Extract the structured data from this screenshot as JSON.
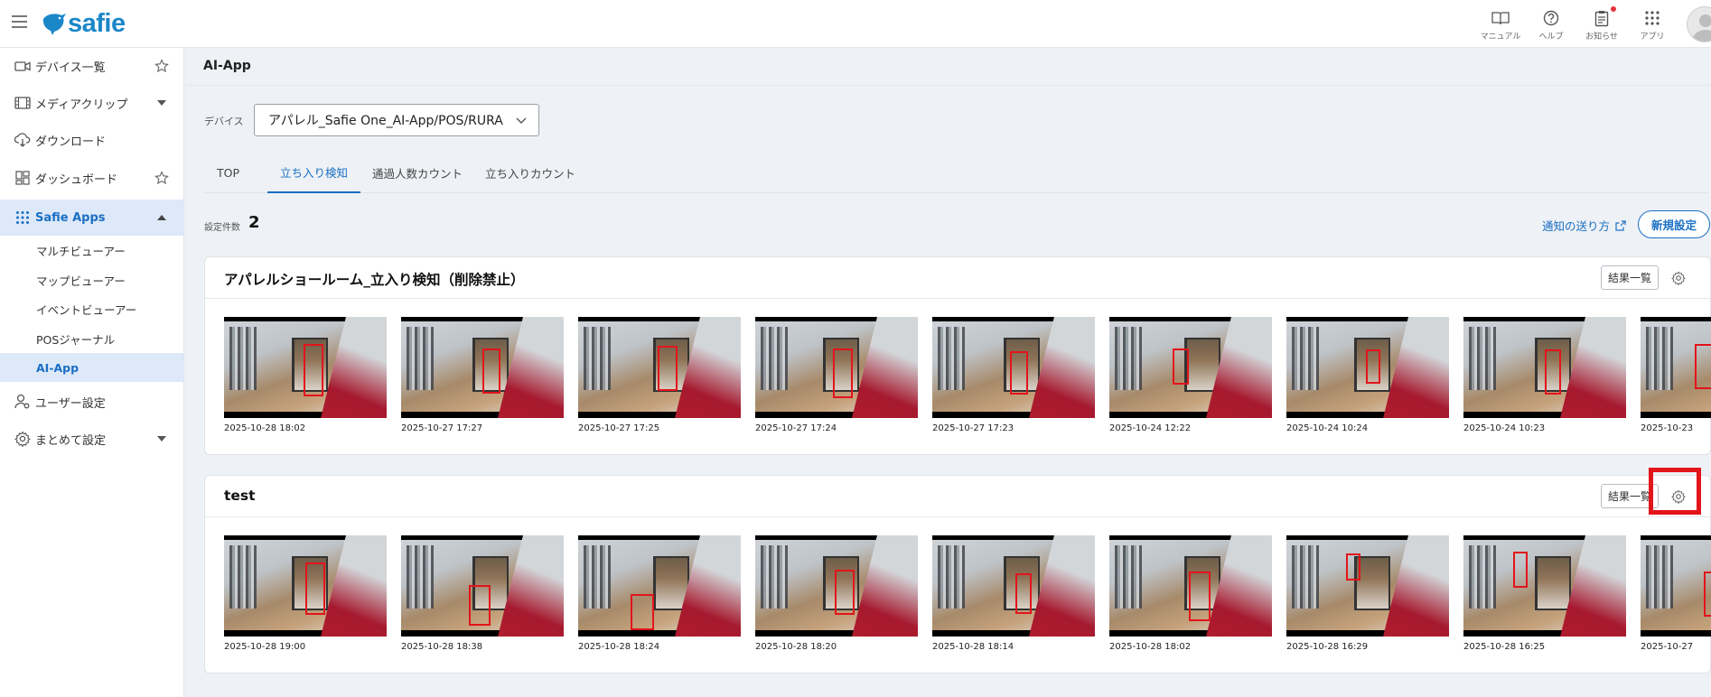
{
  "header": {
    "logo_text": "safie",
    "tools": [
      {
        "icon": "manual-book-icon",
        "label": "マニュアル"
      },
      {
        "icon": "help-question-icon",
        "label": "ヘルプ"
      },
      {
        "icon": "notice-clipboard-icon",
        "label": "お知らせ"
      },
      {
        "icon": "apps-grid-icon",
        "label": "アプリ"
      }
    ]
  },
  "sidebar": {
    "items": [
      {
        "label": "デバイス一覧",
        "icon": "camera-icon",
        "right": "star-icon"
      },
      {
        "label": "メディアクリップ",
        "icon": "film-icon",
        "right": "caret-down-icon"
      },
      {
        "label": "ダウンロード",
        "icon": "cloud-download-icon"
      },
      {
        "label": "ダッシュボード",
        "icon": "dashboard-icon",
        "right": "star-icon"
      },
      {
        "label": "Safie Apps",
        "icon": "apps-dots-icon",
        "right": "caret-up-icon"
      },
      {
        "label": "ユーザー設定",
        "icon": "user-settings-icon"
      },
      {
        "label": "まとめて設定",
        "icon": "gear-icon",
        "right": "caret-down-icon"
      }
    ],
    "sub_items": [
      "マルチビューアー",
      "マップビューアー",
      "イベントビューアー",
      "POSジャーナル",
      "AI-App"
    ]
  },
  "main": {
    "title": "AI-App",
    "device_label": "デバイス",
    "device_value": "アパレル_Safie One_AI-App/POS/RURA",
    "tabs": [
      "TOP",
      "立ち入り検知",
      "通過人数カウント",
      "立ち入りカウント"
    ],
    "active_tab": "立ち入り検知",
    "count_label": "設定件数",
    "count_value": "2",
    "notify_link": "通知の送り方",
    "new_button": "新規設定",
    "cards": [
      {
        "title": "アパレルショールーム_立入り検知（削除禁止）",
        "result_button": "結果一覧",
        "thumbs": [
          "2025-10-28 18:02",
          "2025-10-27 17:27",
          "2025-10-27 17:25",
          "2025-10-27 17:24",
          "2025-10-27 17:23",
          "2025-10-24 12:22",
          "2025-10-24 10:24",
          "2025-10-24 10:23",
          "2025-10-23"
        ]
      },
      {
        "title": "test",
        "result_button": "結果一覧",
        "thumbs": [
          "2025-10-28 19:00",
          "2025-10-28 18:38",
          "2025-10-28 18:24",
          "2025-10-28 18:20",
          "2025-10-28 18:14",
          "2025-10-28 18:02",
          "2025-10-28 16:29",
          "2025-10-28 16:25",
          "2025-10-27"
        ]
      }
    ]
  },
  "colors": {
    "accent": "#1a6fc4",
    "logo": "#1a87c9",
    "highlight": "#e3141b",
    "sidebar_active": "#dde9f8"
  }
}
